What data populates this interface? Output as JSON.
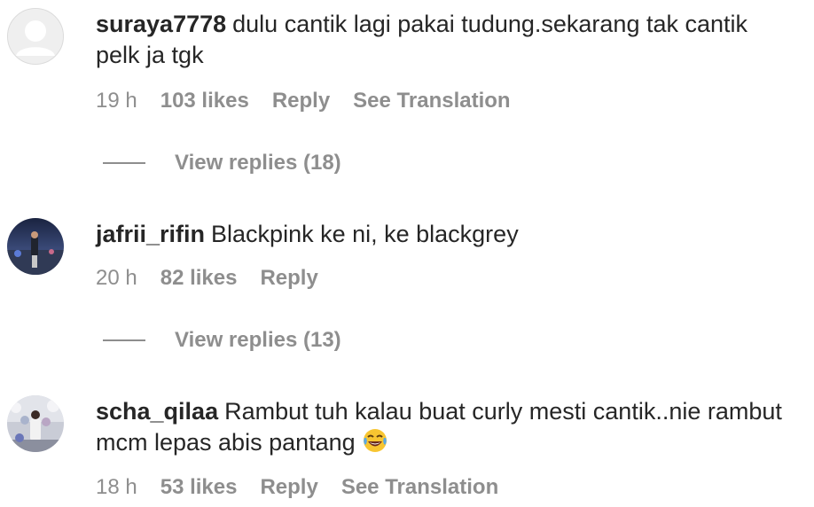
{
  "comments": [
    {
      "username": "suraya7778",
      "text": "dulu cantik lagi pakai tudung.sekarang tak cantik pelk ja tgk",
      "time": "19 h",
      "likes": "103 likes",
      "reply": "Reply",
      "translate": "See Translation",
      "view_replies": "View replies (18)",
      "avatar_icon": "default-avatar-icon"
    },
    {
      "username": "jafrii_rifin",
      "text": "Blackpink ke ni, ke blackgrey",
      "time": "20 h",
      "likes": "82 likes",
      "reply": "Reply",
      "view_replies": "View replies (13)",
      "avatar_icon": "user-photo"
    },
    {
      "username": "scha_qilaa",
      "text": "Rambut tuh kalau buat curly mesti cantik..nie rambut mcm lepas abis pantang",
      "emoji": "laughing-tears-emoji",
      "time": "18 h",
      "likes": "53 likes",
      "reply": "Reply",
      "translate": "See Translation",
      "avatar_icon": "user-photo"
    }
  ],
  "colors": {
    "text": "#262626",
    "meta": "#8e8e8e",
    "avatar_bg": "#dbdbdb"
  }
}
